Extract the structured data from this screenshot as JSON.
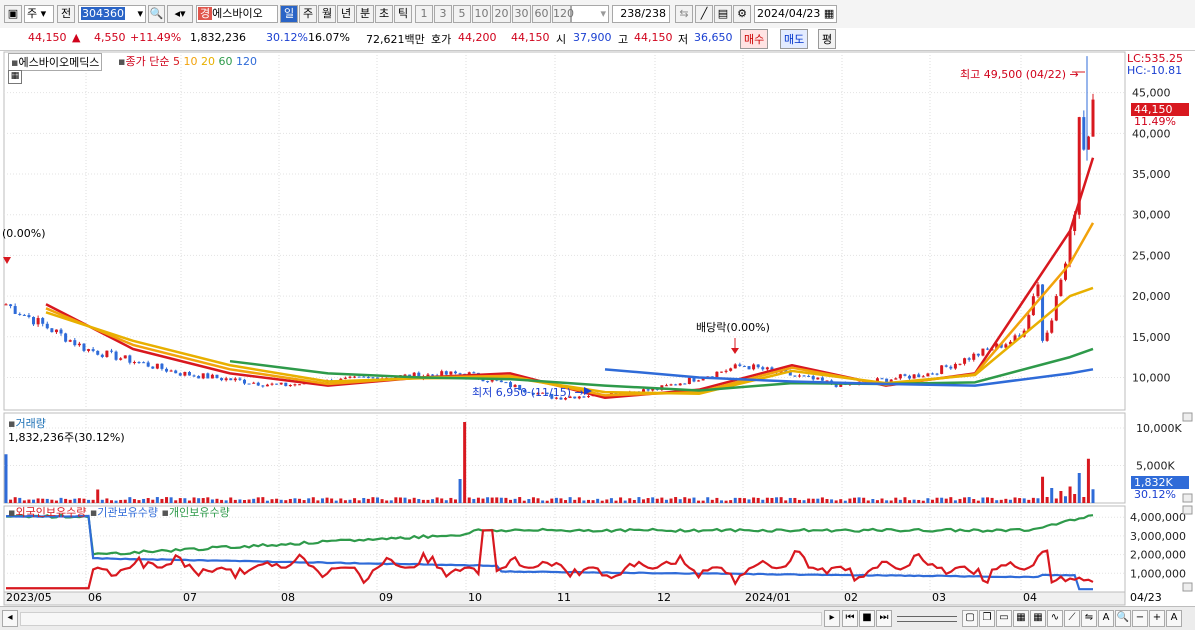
{
  "toolbar": {
    "type_select": "주",
    "prev_label": "전",
    "code": "304360",
    "company_badge": "경",
    "company_name": "에스바이오",
    "periods": [
      "일",
      "주",
      "월",
      "년",
      "분",
      "초",
      "틱"
    ],
    "active_period": "일",
    "intervals": [
      "1",
      "3",
      "5",
      "10",
      "20",
      "30",
      "60",
      "120"
    ],
    "count_current": "238",
    "count_total": "/238",
    "date": "2024/04/23"
  },
  "quote": {
    "price": "44,150",
    "up_mark": "▲",
    "change": "4,550",
    "change_pct": "+11.49%",
    "volume": "1,832,236",
    "vol_ratio": "30.12%",
    "turnover": "16.07%",
    "amount": "72,621백만",
    "ask_label": "호가",
    "ask1": "44,200",
    "ask2": "44,150",
    "open_label": "시",
    "open": "37,900",
    "high_label": "고",
    "high": "44,150",
    "low_label": "저",
    "low": "36,650",
    "buy_label": "매수",
    "sell_label": "매도",
    "eval_label": "평"
  },
  "price_panel": {
    "name_tag": "에스바이오메딕스",
    "ma_title": "종가 단순",
    "ma_periods": [
      "5",
      "10",
      "20",
      "60",
      "120"
    ],
    "ma_colors": [
      "#d8181f",
      "#f2a20b",
      "#e8b000",
      "#2e9a4a",
      "#2f6bd8"
    ],
    "lc": "LC:535.25",
    "hc": "HC:-10.81",
    "y_ticks": [
      "45,000",
      "40,000",
      "35,000",
      "30,000",
      "25,000",
      "20,000",
      "15,000",
      "10,000"
    ],
    "current_price_tag": "44,150",
    "current_pct_tag": "11.49%",
    "high_note": "최고 49,500 (04/22) →",
    "low_note": "최저 6,950 (11/15) →",
    "dividend_note": "배당락(0.00%)",
    "left_note": "(0.00%)"
  },
  "volume_panel": {
    "title": "거래량",
    "value": "1,832,236주(30.12%)",
    "y_ticks": [
      "10,000K",
      "5,000K"
    ],
    "current_tag": "1,832K",
    "current_pct": "30.12%"
  },
  "holding_panel": {
    "series": [
      "외국인보유수량",
      "기관보유수량",
      "개인보유수량"
    ],
    "y_ticks": [
      "4,000,000",
      "3,000,000",
      "2,000,000",
      "1,000,000"
    ]
  },
  "x_axis": [
    "2023/05",
    "06",
    "07",
    "08",
    "09",
    "10",
    "11",
    "12",
    "2024/01",
    "02",
    "03",
    "04",
    "04/23"
  ],
  "chart_data": {
    "type": "line",
    "ylim": [
      6000,
      50000
    ],
    "x": [
      "2023/05",
      "06",
      "07",
      "08",
      "09",
      "10",
      "11",
      "12",
      "2024/01",
      "02",
      "03",
      "04"
    ],
    "series": [
      {
        "name": "5",
        "values": [
          19000,
          13500,
          10500,
          9000,
          10000,
          10500,
          7500,
          8500,
          11500,
          9000,
          10500,
          28000
        ]
      },
      {
        "name": "10",
        "values": [
          18500,
          14000,
          11000,
          9200,
          10000,
          10200,
          7800,
          8200,
          11200,
          9100,
          10400,
          24000
        ]
      },
      {
        "name": "20",
        "values": [
          18000,
          14500,
          11500,
          9500,
          9900,
          10000,
          8200,
          8000,
          10800,
          9300,
          10300,
          20000
        ]
      },
      {
        "name": "60",
        "values": [
          null,
          null,
          12000,
          10500,
          10000,
          9800,
          9000,
          8400,
          9300,
          9200,
          9400,
          12500
        ]
      },
      {
        "name": "120",
        "values": [
          null,
          null,
          null,
          null,
          null,
          null,
          11000,
          10000,
          9500,
          9200,
          9000,
          10500
        ]
      }
    ]
  }
}
